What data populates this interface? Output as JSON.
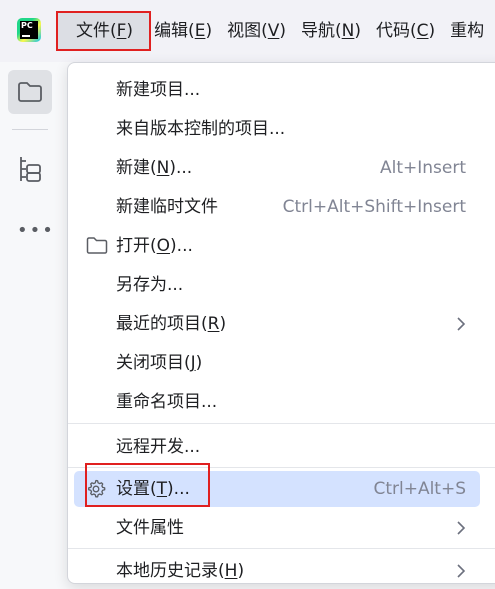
{
  "app": {
    "logo_text": "PC"
  },
  "menubar": {
    "items": [
      {
        "label": "文件(",
        "mnemonic": "F",
        "suffix": ")"
      },
      {
        "label": "编辑(",
        "mnemonic": "E",
        "suffix": ")"
      },
      {
        "label": "视图(",
        "mnemonic": "V",
        "suffix": ")"
      },
      {
        "label": "导航(",
        "mnemonic": "N",
        "suffix": ")"
      },
      {
        "label": "代码(",
        "mnemonic": "C",
        "suffix": ")"
      },
      {
        "label": "重构",
        "mnemonic": "",
        "suffix": ""
      }
    ]
  },
  "toolstrip": {
    "more": "•••"
  },
  "right_glyph": "<",
  "file_menu": {
    "items": [
      {
        "pre": "新建项目...",
        "mn": "",
        "post": "",
        "shortcut": ""
      },
      {
        "pre": "来自版本控制的项目...",
        "mn": "",
        "post": "",
        "shortcut": ""
      },
      {
        "pre": "新建(",
        "mn": "N",
        "post": ")...",
        "shortcut": "Alt+Insert"
      },
      {
        "pre": "新建临时文件",
        "mn": "",
        "post": "",
        "shortcut": "Ctrl+Alt+Shift+Insert"
      },
      {
        "pre": "打开(",
        "mn": "O",
        "post": ")...",
        "shortcut": ""
      },
      {
        "pre": "另存为...",
        "mn": "",
        "post": "",
        "shortcut": ""
      },
      {
        "pre": "最近的项目(",
        "mn": "R",
        "post": ")",
        "shortcut": ""
      },
      {
        "pre": "关闭项目(",
        "mn": "J",
        "post": ")",
        "shortcut": ""
      },
      {
        "pre": "重命名项目...",
        "mn": "",
        "post": "",
        "shortcut": ""
      },
      {
        "pre": "远程开发...",
        "mn": "",
        "post": "",
        "shortcut": ""
      },
      {
        "pre": "设置(",
        "mn": "T",
        "post": ")...",
        "shortcut": "Ctrl+Alt+S"
      },
      {
        "pre": "文件属性",
        "mn": "",
        "post": "",
        "shortcut": ""
      },
      {
        "pre": "本地历史记录(",
        "mn": "H",
        "post": ")",
        "shortcut": ""
      }
    ]
  },
  "colors": {
    "highlight": "#d4e2ff",
    "annotation": "#e02020"
  }
}
